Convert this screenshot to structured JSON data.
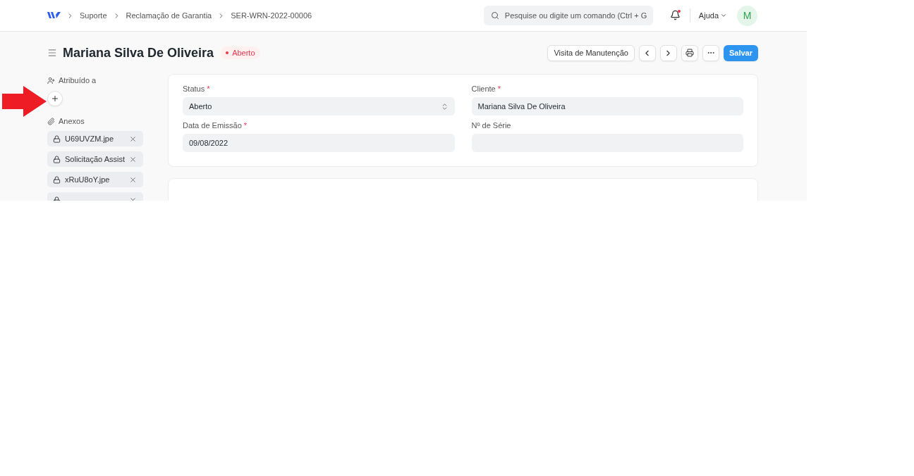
{
  "breadcrumbs": [
    "Suporte",
    "Reclamação de Garantia",
    "SER-WRN-2022-00006"
  ],
  "search": {
    "placeholder": "Pesquise ou digite um comando (Ctrl + G"
  },
  "notifications": {
    "unread": true
  },
  "help": {
    "label": "Ajuda"
  },
  "avatar": {
    "initial": "M"
  },
  "title": "Mariana Silva De Oliveira",
  "status": {
    "label": "Aberto",
    "color": "#e5384f"
  },
  "actions": [
    {
      "kind": "text",
      "label": "Visita de Manutenção"
    },
    {
      "kind": "prev"
    },
    {
      "kind": "next"
    },
    {
      "kind": "print"
    },
    {
      "kind": "more"
    },
    {
      "kind": "primary",
      "label": "Salvar"
    }
  ],
  "sidebar": {
    "assigned_label": "Atribuído a",
    "attachments_label": "Anexos",
    "attachments": [
      {
        "kind": "file",
        "name": "U69UVZM.jpe"
      },
      {
        "kind": "file",
        "name": "Solicitação Assist"
      },
      {
        "kind": "file",
        "name": "xRuU8oY.jpe"
      },
      {
        "kind": "cut"
      }
    ]
  },
  "fields": [
    {
      "label": "Status",
      "required_mark": "*",
      "kind": "select",
      "value": "Aberto"
    },
    {
      "label": "Cliente",
      "required_mark": "*",
      "kind": "text",
      "value": "Mariana Silva De Oliveira"
    },
    {
      "label": "Data de Emissão",
      "required_mark": "*",
      "kind": "text",
      "value": "09/08/2022"
    },
    {
      "label": "Nº de Série",
      "kind": "text"
    }
  ],
  "annotation": {
    "kind": "arrow"
  }
}
